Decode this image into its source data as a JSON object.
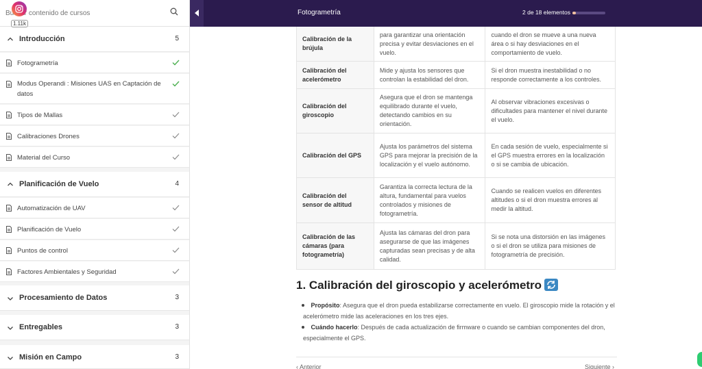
{
  "search": {
    "placeholder": "Buscar contenido de cursos"
  },
  "social": {
    "count": "1.11k"
  },
  "sections": [
    {
      "title": "Introducción",
      "count": "5",
      "expanded": true,
      "lessons": [
        {
          "label": "Fotogrametría"
        },
        {
          "label": "Modus Operandi : Misiones UAS en Captación de datos"
        },
        {
          "label": "Tipos de Mallas"
        },
        {
          "label": "Calibraciones Drones"
        },
        {
          "label": "Material del Curso"
        }
      ]
    },
    {
      "title": "Planificación de Vuelo",
      "count": "4",
      "expanded": true,
      "lessons": [
        {
          "label": "Automatización de UAV"
        },
        {
          "label": "Planificación de Vuelo"
        },
        {
          "label": "Puntos de control"
        },
        {
          "label": "Factores Ambientales y Seguridad"
        }
      ]
    },
    {
      "title": "Procesamiento de Datos",
      "count": "3",
      "expanded": false
    },
    {
      "title": "Entregables",
      "count": "3",
      "expanded": false
    },
    {
      "title": "Misión en Campo",
      "count": "3",
      "expanded": false
    }
  ],
  "topbar": {
    "title": "Fotogrametría",
    "count": "2 de 18 elementos",
    "progress": 0.1111
  },
  "table": {
    "rows": [
      [
        "Calibración de la brújula",
        "para garantizar una orientación precisa y evitar desviaciones en el vuelo.",
        "cuando el dron se mueve a una nueva área o si hay desviaciones en el comportamiento de vuelo."
      ],
      [
        "Calibración del acelerómetro",
        "Mide y ajusta los sensores que controlan la estabilidad del dron.",
        "Si el dron muestra inestabilidad o no responde correctamente a los controles."
      ],
      [
        "Calibración del giroscopio",
        "Asegura que el dron se mantenga equilibrado durante el vuelo, detectando cambios en su orientación.",
        "Al observar vibraciones excesivas o dificultades para mantener el nivel durante el vuelo."
      ],
      [
        "Calibración del GPS",
        "Ajusta los parámetros del sistema GPS para mejorar la precisión de la localización y el vuelo autónomo.",
        "En cada sesión de vuelo, especialmente si el GPS muestra errores en la localización o si se cambia de ubicación."
      ],
      [
        "Calibración del sensor de altitud",
        "Garantiza la correcta lectura de la altura, fundamental para vuelos controlados y misiones de fotogrametría.",
        "Cuando se realicen vuelos en diferentes altitudes o si el dron muestra errores al medir la altitud."
      ],
      [
        "Calibración de las cámaras (para fotogrametría)",
        "Ajusta las cámaras del dron para asegurarse de que las imágenes capturadas sean precisas y de alta calidad.",
        "Si se nota una distorsión en las imágenes o si el dron se utiliza para misiones de fotogrametría de precisión."
      ]
    ]
  },
  "content": {
    "heading": "1. Calibración del giroscopio y acelerómetro",
    "bullet1_label": "Propósito",
    "bullet1_text": ": Asegura que el dron pueda estabilizarse correctamente en vuelo. El giroscopio mide la rotación y el acelerómetro mide las aceleraciones en los tres ejes.",
    "bullet2_label": "Cuándo hacerlo",
    "bullet2_text": ": Después de cada actualización de firmware o cuando se cambian componentes del dron, especialmente el GPS."
  },
  "nav": {
    "prev": "Anterior",
    "next": "Siguiente"
  },
  "colors": {
    "topbar": "#2b1b4e",
    "check": "#4caf50",
    "sync_icon": "#3b88c3"
  },
  "icons": {
    "search": "search-icon",
    "lesson": "document-icon",
    "done": "check-icon",
    "section": "chevron-icon",
    "heading_emoji": "sync-arrows-icon"
  }
}
